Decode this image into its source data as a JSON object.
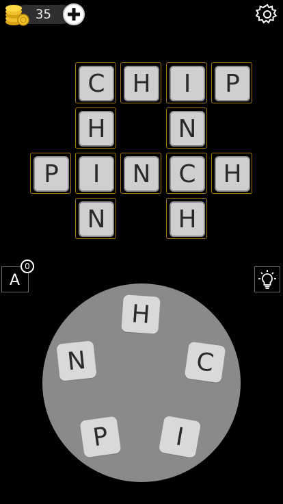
{
  "header": {
    "coins": "35",
    "icons": {
      "coins": "coin-stack-icon",
      "add": "plus-icon",
      "settings": "gear-icon"
    }
  },
  "board": {
    "letters": {
      "C1": "C",
      "H1": "H",
      "I1": "I",
      "P1": "P",
      "H2": "H",
      "N2": "N",
      "P3": "P",
      "I3": "I",
      "N3": "N",
      "C3": "C",
      "H3": "H",
      "N4": "N",
      "H4": "H"
    }
  },
  "controls": {
    "shuffle_letter": "A",
    "shuffle_count": "0",
    "hint_icon": "lightbulb-icon"
  },
  "wheel": {
    "letters": [
      "H",
      "C",
      "I",
      "P",
      "N"
    ]
  },
  "colors": {
    "background": "#000000",
    "tile": "#cfcfcf",
    "cell_border": "#a07a10",
    "wheel": "#8a8a8a"
  }
}
